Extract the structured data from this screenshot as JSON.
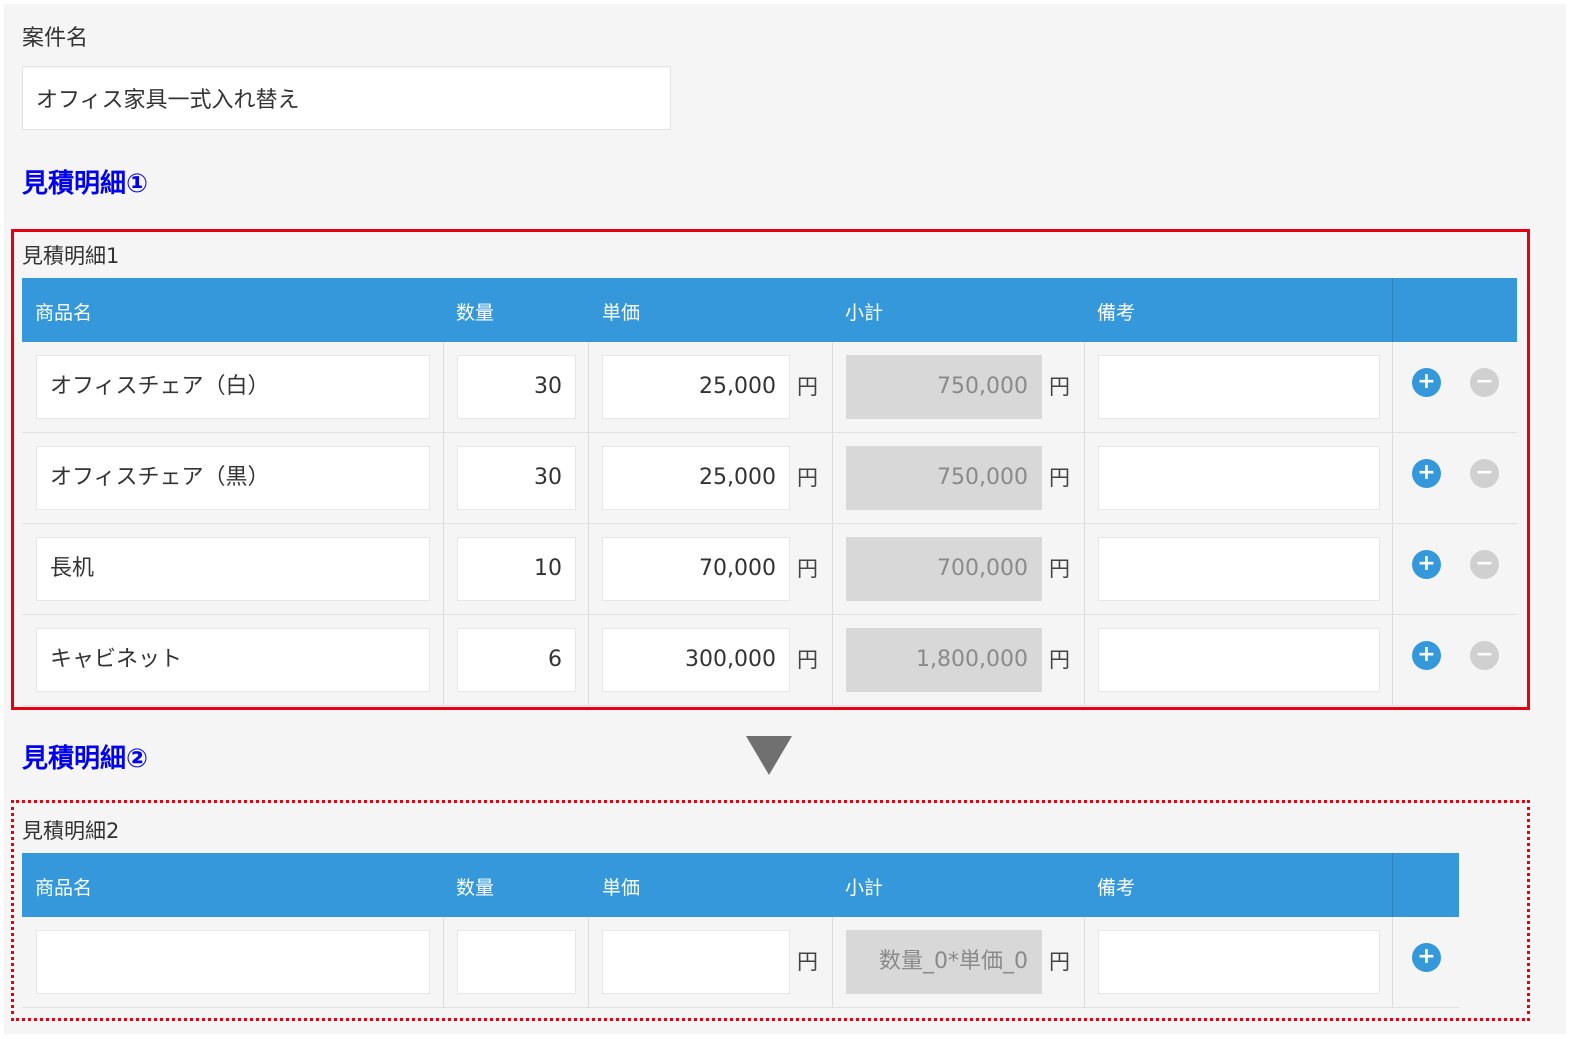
{
  "project": {
    "label": "案件名",
    "value": "オフィス家具一式入れ替え"
  },
  "section1": {
    "heading": "見積明細①",
    "table_label": "見積明細1"
  },
  "section2": {
    "heading": "見積明細②",
    "table_label": "見積明細2"
  },
  "columns": {
    "name": "商品名",
    "qty": "数量",
    "unit_price": "単価",
    "subtotal": "小計",
    "notes": "備考"
  },
  "currency_unit": "円",
  "table1_rows": [
    {
      "name": "オフィスチェア（白）",
      "qty": "30",
      "unit_price": "25,000",
      "subtotal": "750,000",
      "notes": ""
    },
    {
      "name": "オフィスチェア（黒）",
      "qty": "30",
      "unit_price": "25,000",
      "subtotal": "750,000",
      "notes": ""
    },
    {
      "name": "長机",
      "qty": "10",
      "unit_price": "70,000",
      "subtotal": "700,000",
      "notes": ""
    },
    {
      "name": "キャビネット",
      "qty": "6",
      "unit_price": "300,000",
      "subtotal": "1,800,000",
      "notes": ""
    }
  ],
  "table2_rows": [
    {
      "name": "",
      "qty": "",
      "unit_price": "",
      "subtotal": "数量_0*単価_0",
      "notes": ""
    }
  ],
  "icons": {
    "add": "+",
    "remove": "−"
  },
  "colors": {
    "header_bg": "#3498db",
    "heading_text": "#0000ee",
    "highlight_border": "#e60012",
    "arrow": "#707070"
  }
}
